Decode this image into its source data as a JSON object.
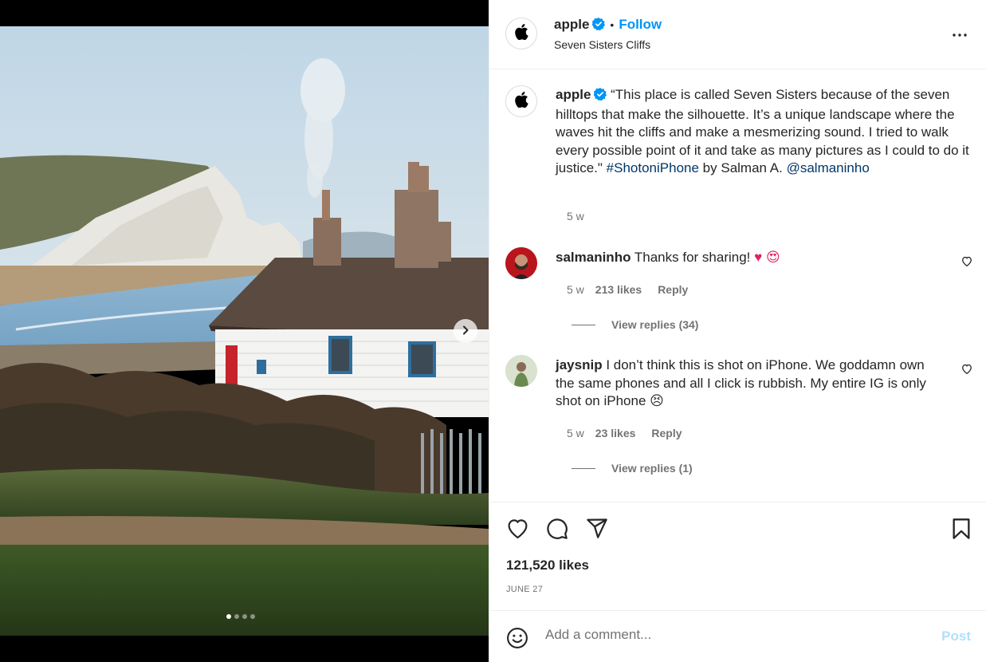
{
  "post": {
    "username": "apple",
    "follow_label": "Follow",
    "separator": "•",
    "location": "Seven Sisters Cliffs",
    "more_icon": "more-horizontal-icon",
    "carousel": {
      "dot_count": 4,
      "active_index": 0
    }
  },
  "caption": {
    "username": "apple",
    "text_1": "“This place is called Seven Sisters because of the seven hilltops that make the silhouette. It’s a unique landscape where the waves hit the cliffs and make a mesmerizing sound. I tried to walk every possible point of it and take as many pictures as I could to do it justice.\" ",
    "hashtag": "#ShotoniPhone",
    "text_2": " by Salman A. ",
    "mention": "@salmaninho",
    "time": "5 w"
  },
  "comments": [
    {
      "username": "salmaninho",
      "text": "Thanks for sharing! ",
      "emoji": "♥ 😍",
      "time": "5 w",
      "likes": "213 likes",
      "reply_label": "Reply",
      "view_replies": "View replies (34)"
    },
    {
      "username": "jaysnip",
      "text": "I don’t think this is shot on iPhone. We goddamn own the same phones and all I click is rubbish. My entire IG is only shot on iPhone ",
      "emoji": "😣",
      "time": "5 w",
      "likes": "23 likes",
      "reply_label": "Reply",
      "view_replies": "View replies (1)"
    }
  ],
  "engagement": {
    "likes": "121,520 likes",
    "date": "JUNE 27"
  },
  "add_comment": {
    "placeholder": "Add a comment...",
    "post_label": "Post"
  },
  "colors": {
    "accent": "#0095f6",
    "post_disabled": "#b2dffc",
    "link": "#00376b",
    "secondary_text": "#737373"
  }
}
